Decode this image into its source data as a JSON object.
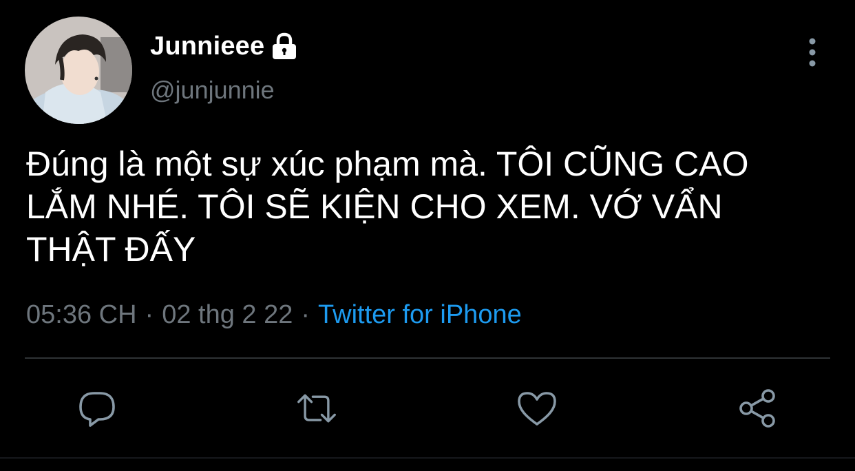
{
  "user": {
    "display_name": "Junnieee",
    "handle": "@junjunnie",
    "protected": true
  },
  "tweet": {
    "text": "Đúng là một sự xúc phạm mà. TÔI CŨNG CAO LẮM NHÉ. TÔI SẼ KIỆN CHO XEM. VỚ VẨN THẬT ĐẤY",
    "time": "05:36 CH",
    "date": "02 thg 2 22",
    "separator": "·",
    "source": "Twitter for iPhone"
  },
  "icons": {
    "lock": "lock-icon",
    "more": "more-vertical-icon",
    "reply": "reply-icon",
    "retweet": "retweet-icon",
    "like": "like-icon",
    "share": "share-icon"
  },
  "colors": {
    "background": "#000000",
    "primary_text": "#ffffff",
    "secondary_text": "#6e767d",
    "link": "#1d9bf0",
    "icon": "#8899a6",
    "divider": "#2f3336"
  }
}
